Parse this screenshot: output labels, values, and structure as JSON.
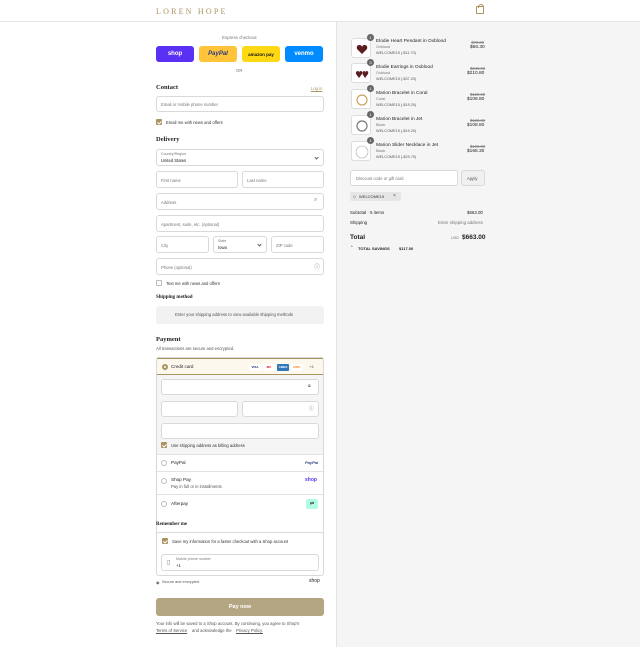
{
  "header": {
    "brand": "LOREN HOPE"
  },
  "express": {
    "label": "Express checkout",
    "or": "OR",
    "shop": "shop",
    "paypal": "PayPal",
    "amazon": "amazon pay",
    "venmo": "venmo"
  },
  "contact": {
    "title": "Contact",
    "login": "Log in",
    "email_placeholder": "Email or mobile phone number",
    "news_label": "Email me with news and offers"
  },
  "delivery": {
    "title": "Delivery",
    "country_label": "Country/Region",
    "country_value": "United States",
    "first_name": "First name",
    "last_name": "Last name",
    "address": "Address",
    "apartment": "Apartment, suite, etc. (optional)",
    "city": "City",
    "state_label": "State",
    "state_value": "Iowa",
    "zip": "ZIP code",
    "phone": "Phone (optional)",
    "text_label": "Text me with news and offers"
  },
  "shipping": {
    "title": "Shipping method",
    "message": "Enter your shipping address to view available shipping methods"
  },
  "payment": {
    "title": "Payment",
    "subtitle": "All transactions are secure and encrypted.",
    "credit_card": "Credit card",
    "more_cards": "+4",
    "card_brands": [
      "VISA",
      "MC",
      "AMEX",
      "DISC"
    ],
    "billing_label": "Use shipping address as billing address",
    "paypal": "PayPal",
    "paypal_logo": "PayPal",
    "shop_pay": "Shop Pay",
    "shop_pay_sub": "Pay in full or in installments",
    "shop_logo": "shop",
    "afterpay": "Afterpay"
  },
  "remember": {
    "title": "Remember me",
    "save_label": "Save my information for a faster checkout with a Shop account",
    "phone_label": "Mobile phone number",
    "phone_value": "+1",
    "secure": "Secure and encrypted",
    "shop_logo": "shop"
  },
  "pay_button": "Pay now",
  "footer": {
    "line1": "Your info will be saved to a Shop account. By continuing, you agree to Shop's",
    "terms": "Terms of Service",
    "and": "and acknowledge the",
    "privacy": "Privacy Policy."
  },
  "cart": {
    "items": [
      {
        "qty": "1",
        "name": "Elodie Heart Pendant in Oxblood",
        "variant": "Oxblood",
        "discount": "WELCOME15 (-$11.70)",
        "old_price": "$78.00",
        "price": "$66.30"
      },
      {
        "qty": "3",
        "name": "Elodie Earrings in Oxblood",
        "variant": "Oxblood",
        "discount": "WELCOME15 (-$37.20)",
        "old_price": "$248.00",
        "price": "$210.80"
      },
      {
        "qty": "1",
        "name": "Marion Bracelet in Coral",
        "variant": "Coral",
        "discount": "WELCOME15 (-$19.20)",
        "old_price": "$128.00",
        "price": "$108.80"
      },
      {
        "qty": "1",
        "name": "Marion Bracelet in Jet",
        "variant": "Black",
        "discount": "WELCOME15 (-$19.20)",
        "old_price": "$128.00",
        "price": "$108.80"
      },
      {
        "qty": "1",
        "name": "Marion Slider Necklace in Jet",
        "variant": "Black",
        "discount": "WELCOME15 (-$29.70)",
        "old_price": "$198.00",
        "price": "$168.30"
      }
    ],
    "discount_placeholder": "Discount code or gift card",
    "apply": "Apply",
    "code_tag": "WELCOME15",
    "subtotal_label": "Subtotal · 5 items",
    "subtotal_value": "$663.00",
    "shipping_label": "Shipping",
    "shipping_value": "Enter shipping address",
    "total_label": "Total",
    "currency": "USD",
    "total_value": "$663.00",
    "savings_label": "TOTAL SAVINGS",
    "savings_value": "$117.00"
  }
}
